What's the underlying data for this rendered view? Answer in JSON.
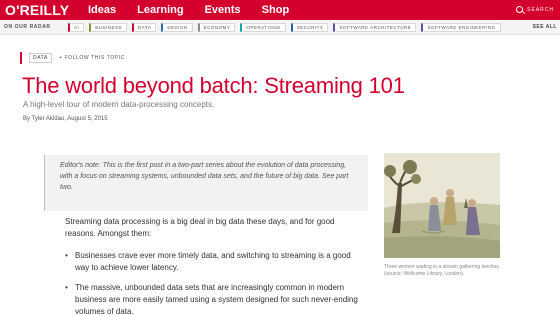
{
  "brand": {
    "logo": "O'REILLY",
    "accent": "#d3002d"
  },
  "nav": {
    "items": [
      "Ideas",
      "Learning",
      "Events",
      "Shop"
    ],
    "search_label": "SEARCH"
  },
  "radar": {
    "label": "ON OUR RADAR",
    "topics": [
      {
        "label": "AI",
        "color": "#d3002d"
      },
      {
        "label": "BUSINESS",
        "color": "#7a9a2e"
      },
      {
        "label": "DATA",
        "color": "#d3002d"
      },
      {
        "label": "DESIGN",
        "color": "#2a6fa8"
      },
      {
        "label": "ECONOMY",
        "color": "#888888"
      },
      {
        "label": "OPERATIONS",
        "color": "#19a3a3"
      },
      {
        "label": "SECURITY",
        "color": "#1f5fa8"
      },
      {
        "label": "SOFTWARE ARCHITECTURE",
        "color": "#6a4aa0"
      },
      {
        "label": "SOFTWARE ENGINEERING",
        "color": "#6a4aa0"
      }
    ],
    "see_all": "SEE ALL"
  },
  "article": {
    "tag": "DATA",
    "follow": "+ FOLLOW THIS TOPIC",
    "title": "The world beyond batch: Streaming 101",
    "subtitle": "A high-level tour of modern data-processing concepts.",
    "byline": "By Tyler Akidau, August 5, 2015",
    "editors_note": "Editor's note: This is the first post in a two-part series about the evolution of data processing, with a focus on streaming systems, unbounded data sets, and the future of big data. See part two.",
    "intro": "Streaming data processing is a big deal in big data these days, and for good reasons. Amongst them:",
    "bullets": [
      "Businesses crave ever more timely data, and switching to streaming is a good way to achieve lower latency.",
      "The massive, unbounded data sets that are increasingly common in modern business are more easily tamed using a system designed for such never-ending volumes of data."
    ]
  },
  "figure": {
    "caption": "Three women wading in a stream gathering leeches (source: Wellcome Library, London)."
  }
}
